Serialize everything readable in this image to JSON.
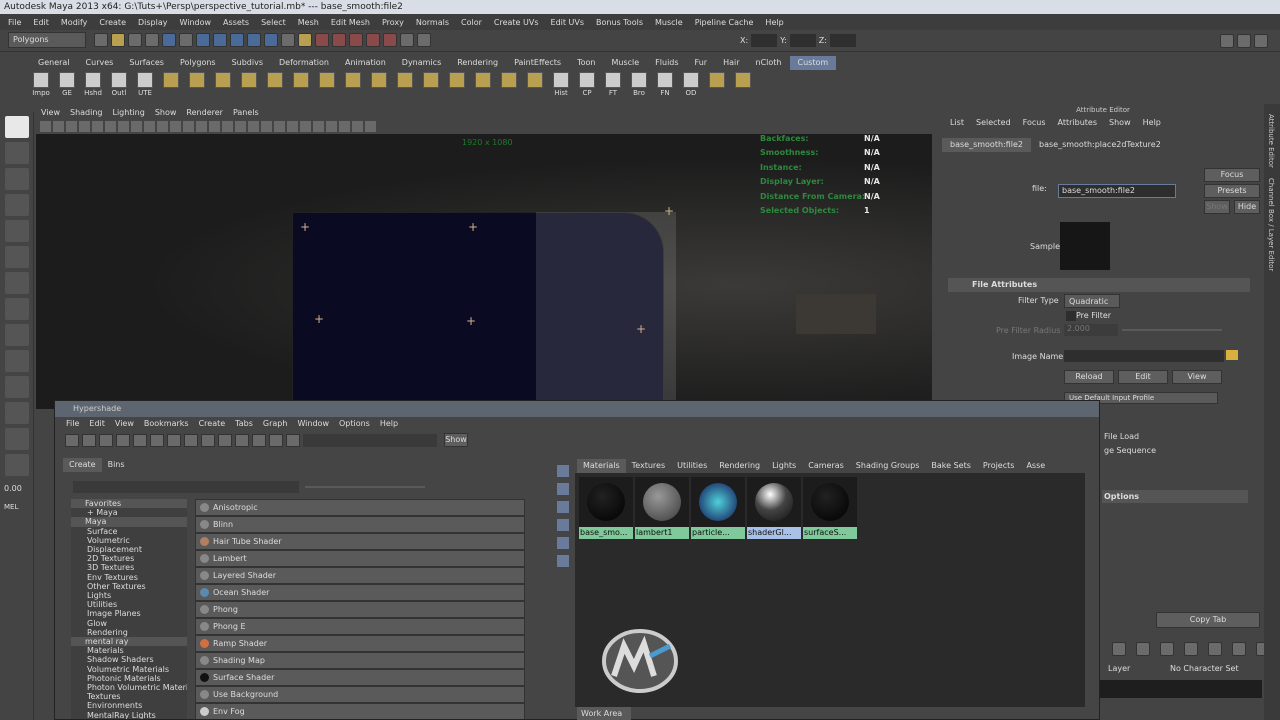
{
  "window": {
    "title": "Autodesk Maya 2013 x64: G:\\Tuts+\\Persp\\perspective_tutorial.mb*   ---   base_smooth:file2"
  },
  "menubar": [
    "File",
    "Edit",
    "Modify",
    "Create",
    "Display",
    "Window",
    "Assets",
    "Select",
    "Mesh",
    "Edit Mesh",
    "Proxy",
    "Normals",
    "Color",
    "Create UVs",
    "Edit UVs",
    "Bonus Tools",
    "Muscle",
    "Pipeline Cache",
    "Help"
  ],
  "status": {
    "mode": "Polygons",
    "x_label": "X:",
    "y_label": "Y:",
    "z_label": "Z:"
  },
  "shelf_tabs": [
    "General",
    "Curves",
    "Surfaces",
    "Polygons",
    "Subdivs",
    "Deformation",
    "Animation",
    "Dynamics",
    "Rendering",
    "PaintEffects",
    "Toon",
    "Muscle",
    "Fluids",
    "Fur",
    "Hair",
    "nCloth",
    "Custom"
  ],
  "shelf_active": "Custom",
  "shelf_buttons": [
    "Impo",
    "GE",
    "Hshd",
    "Outl",
    "UTE",
    "Hist",
    "CP",
    "FT",
    "Bro",
    "FN",
    "OD"
  ],
  "panel_menu": [
    "View",
    "Shading",
    "Lighting",
    "Show",
    "Renderer",
    "Panels"
  ],
  "viewport": {
    "resolution": "1920 x 1080",
    "hud_labels": [
      "Backfaces:",
      "Smoothness:",
      "Instance:",
      "Display Layer:",
      "Distance From Camera:",
      "Selected Objects:"
    ],
    "hud_values": [
      "N/A",
      "N/A",
      "N/A",
      "N/A",
      "N/A",
      "1"
    ]
  },
  "attribute_editor": {
    "title": "Attribute Editor",
    "menu": [
      "List",
      "Selected",
      "Focus",
      "Attributes",
      "Show",
      "Help"
    ],
    "tabs": [
      "base_smooth:file2",
      "base_smooth:place2dTexture2"
    ],
    "file_label": "file:",
    "file_value": "base_smooth:file2",
    "focus": "Focus",
    "presets": "Presets",
    "show": "Show",
    "hide": "Hide",
    "sample_label": "Sample",
    "section_file_attributes": "File Attributes",
    "filter_type_label": "Filter Type",
    "filter_type_value": "Quadratic",
    "pre_filter": "Pre Filter",
    "pre_filter_radius_label": "Pre Filter Radius",
    "pre_filter_radius_value": "2.000",
    "image_name_label": "Image Name",
    "reload": "Reload",
    "edit": "Edit",
    "view": "View",
    "color_profile_value": "Use Default Input Profile",
    "file_load": "File Load",
    "image_sequence": "ge Sequence",
    "options": "Options",
    "copy_tab": "Copy Tab",
    "layer": "Layer",
    "no_character_set": "No Character Set"
  },
  "side_tabs": [
    "Attribute Editor",
    "Channel Box / Layer Editor"
  ],
  "toolbox_values": {
    "frame": "0.00",
    "mel": "MEL"
  },
  "hypershade": {
    "title": "Hypershade",
    "menu": [
      "File",
      "Edit",
      "View",
      "Bookmarks",
      "Create",
      "Tabs",
      "Graph",
      "Window",
      "Options",
      "Help"
    ],
    "show_button": "Show",
    "left_tabs": [
      "Create",
      "Bins"
    ],
    "tree": [
      {
        "label": "Favorites",
        "type": "hdr"
      },
      {
        "label": "+ Maya",
        "type": "sub"
      },
      {
        "label": "Maya",
        "type": "hdr"
      },
      {
        "label": "Surface",
        "type": "sub"
      },
      {
        "label": "Volumetric",
        "type": "sub"
      },
      {
        "label": "Displacement",
        "type": "sub"
      },
      {
        "label": "2D Textures",
        "type": "sub"
      },
      {
        "label": "3D Textures",
        "type": "sub"
      },
      {
        "label": "Env Textures",
        "type": "sub"
      },
      {
        "label": "Other Textures",
        "type": "sub"
      },
      {
        "label": "Lights",
        "type": "sub"
      },
      {
        "label": "Utilities",
        "type": "sub"
      },
      {
        "label": "Image Planes",
        "type": "sub"
      },
      {
        "label": "Glow",
        "type": "sub"
      },
      {
        "label": "Rendering",
        "type": "sub"
      },
      {
        "label": "mental ray",
        "type": "hdr"
      },
      {
        "label": "Materials",
        "type": "sub"
      },
      {
        "label": "Shadow Shaders",
        "type": "sub"
      },
      {
        "label": "Volumetric Materials",
        "type": "sub"
      },
      {
        "label": "Photonic Materials",
        "type": "sub"
      },
      {
        "label": "Photon Volumetric Materi...",
        "type": "sub"
      },
      {
        "label": "Textures",
        "type": "sub"
      },
      {
        "label": "Environments",
        "type": "sub"
      },
      {
        "label": "MentalRay Lights",
        "type": "sub"
      }
    ],
    "nodes": [
      "Anisotropic",
      "Blinn",
      "Hair Tube Shader",
      "Lambert",
      "Layered Shader",
      "Ocean Shader",
      "Phong",
      "Phong E",
      "Ramp Shader",
      "Shading Map",
      "Surface Shader",
      "Use Background",
      "Env Fog"
    ],
    "right_tabs": [
      "Materials",
      "Textures",
      "Utilities",
      "Rendering",
      "Lights",
      "Cameras",
      "Shading Groups",
      "Bake Sets",
      "Projects",
      "Asse"
    ],
    "materials": [
      "base_smo...",
      "lambert1",
      "particle...",
      "shaderGl...",
      "surfaceS..."
    ],
    "work_area": "Work Area"
  },
  "colors": {
    "accent": "#6a7a9a",
    "swatch_label": "#7fc99a",
    "swatch_selected": "#a9c1e8",
    "hud_green": "#2d8a3d"
  }
}
